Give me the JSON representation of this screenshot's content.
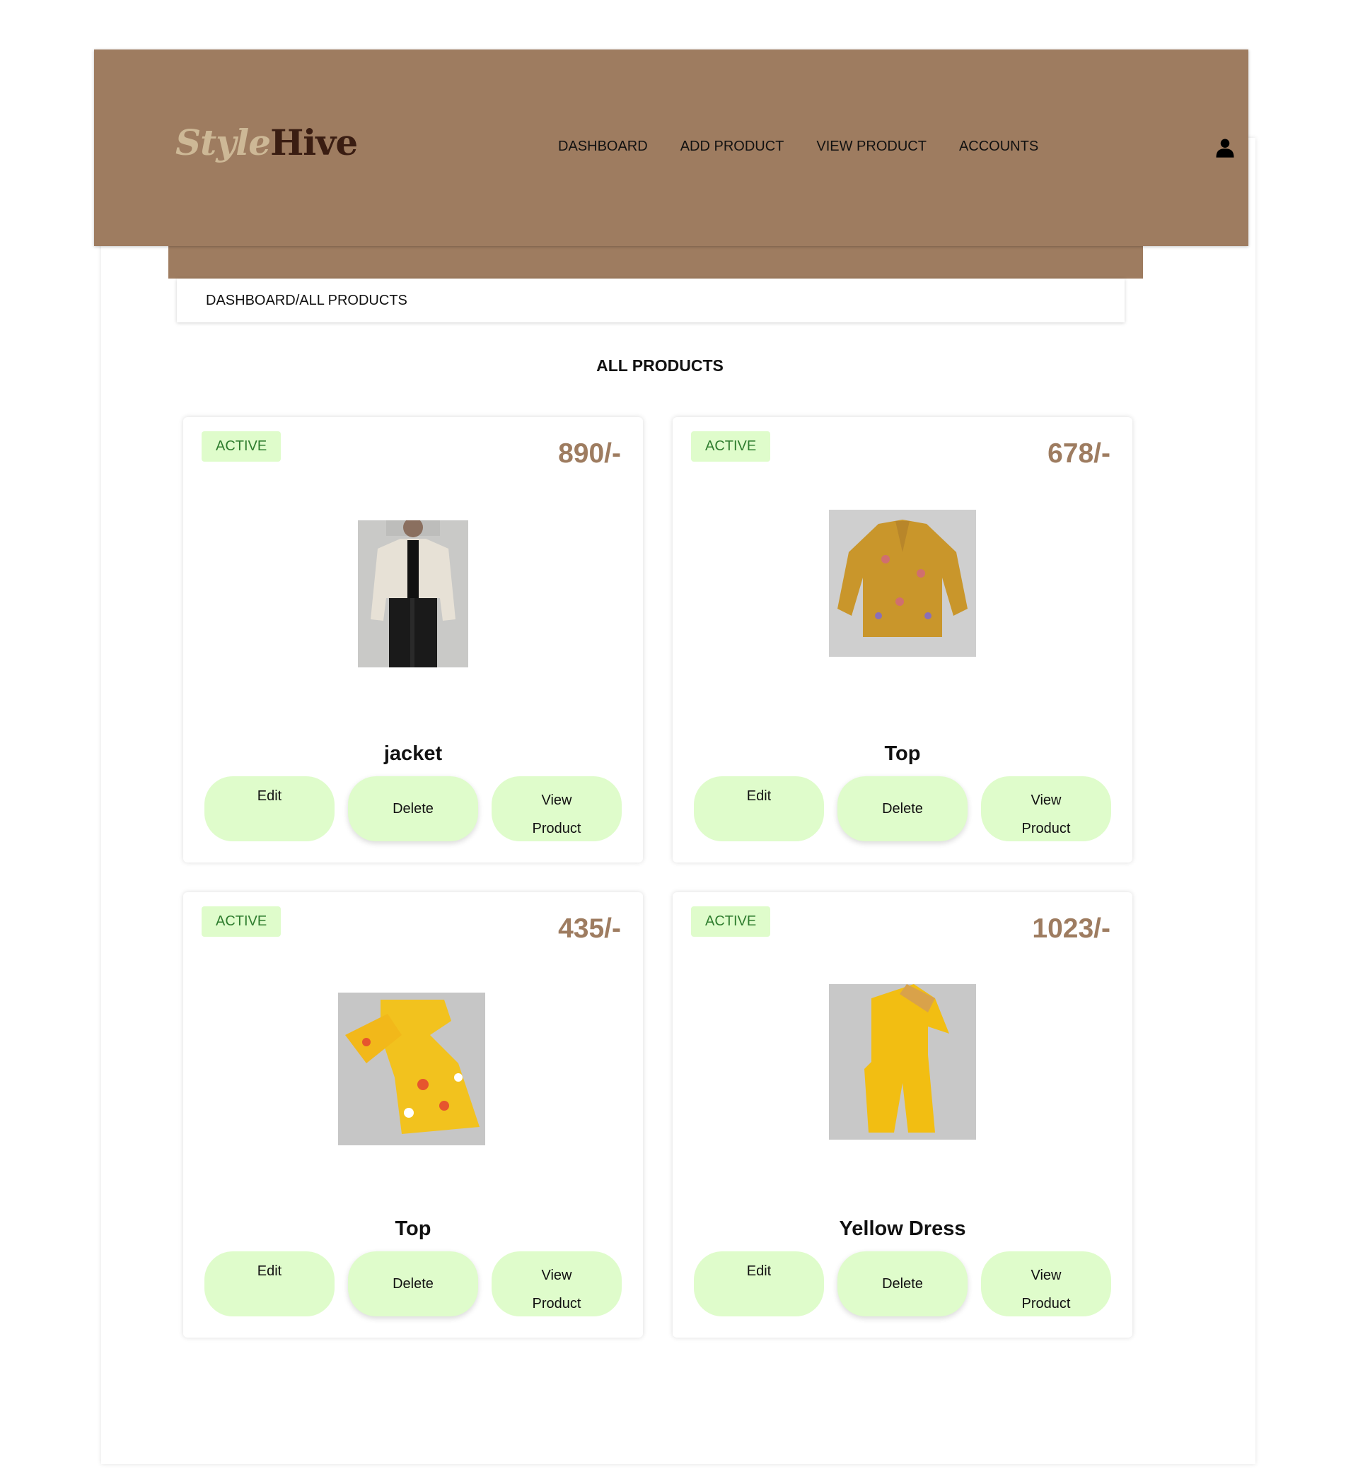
{
  "brand": {
    "logo_part1": "Style",
    "logo_part2": "Hive"
  },
  "nav": {
    "items": [
      {
        "label": "DASHBOARD"
      },
      {
        "label": "ADD PRODUCT"
      },
      {
        "label": "VIEW PRODUCT"
      },
      {
        "label": "ACCOUNTS"
      }
    ],
    "user_icon": "user-icon"
  },
  "breadcrumb": "DASHBOARD/ALL PRODUCTS",
  "page_title": "ALL PRODUCTS",
  "colors": {
    "header_bg": "#9e7c60",
    "badge_bg": "#dffccb",
    "badge_text": "#2e7d2e",
    "price_text": "#9e7c60",
    "button_bg": "#dffccb"
  },
  "products": [
    {
      "status": "ACTIVE",
      "price": "890/-",
      "name": "jacket",
      "image_icon": "jacket-photo",
      "edit_label": "Edit",
      "delete_label": "Delete",
      "view_label_line1": "View",
      "view_label_line2": "Product"
    },
    {
      "status": "ACTIVE",
      "price": "678/-",
      "name": "Top",
      "image_icon": "floral-top-photo",
      "edit_label": "Edit",
      "delete_label": "Delete",
      "view_label_line1": "View",
      "view_label_line2": "Product"
    },
    {
      "status": "ACTIVE",
      "price": "435/-",
      "name": "Top",
      "image_icon": "yellow-frock-photo",
      "edit_label": "Edit",
      "delete_label": "Delete",
      "view_label_line1": "View",
      "view_label_line2": "Product"
    },
    {
      "status": "ACTIVE",
      "price": "1023/-",
      "name": "Yellow Dress",
      "image_icon": "yellow-dress-photo",
      "edit_label": "Edit",
      "delete_label": "Delete",
      "view_label_line1": "View",
      "view_label_line2": "Product"
    }
  ]
}
